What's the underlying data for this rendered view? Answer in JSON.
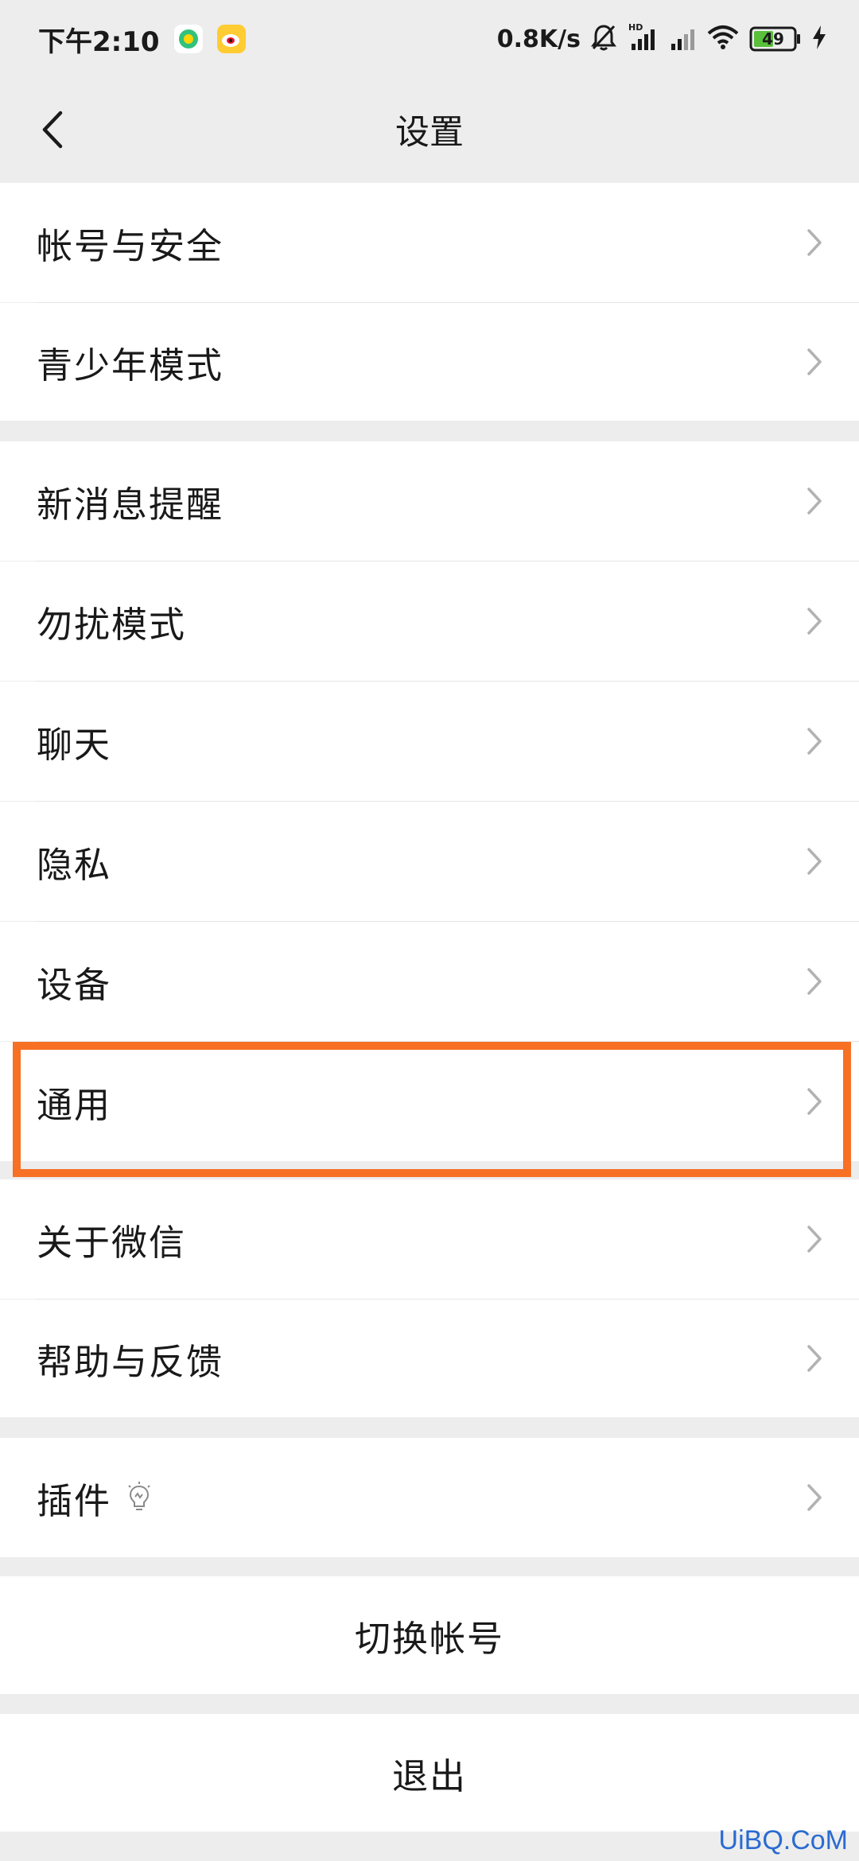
{
  "status_bar": {
    "time": "下午2:10",
    "app_icons": [
      "qq-music-icon",
      "weibo-icon"
    ],
    "net_speed": "0.8K/s",
    "battery": "49",
    "icons": [
      "bell-muted-icon",
      "signal-hd-icon",
      "signal-icon",
      "wifi-icon",
      "battery-icon",
      "charging-icon"
    ]
  },
  "nav": {
    "title": "设置",
    "back_icon": "chevron-left-icon"
  },
  "groups": [
    {
      "items": [
        {
          "label": "帐号与安全"
        },
        {
          "label": "青少年模式"
        }
      ]
    },
    {
      "items": [
        {
          "label": "新消息提醒"
        },
        {
          "label": "勿扰模式"
        },
        {
          "label": "聊天"
        },
        {
          "label": "隐私"
        },
        {
          "label": "设备"
        },
        {
          "label": "通用"
        }
      ]
    },
    {
      "items": [
        {
          "label": "关于微信"
        },
        {
          "label": "帮助与反馈"
        }
      ]
    },
    {
      "items": [
        {
          "label": "插件"
        }
      ]
    }
  ],
  "actions": {
    "switch_account": "切换帐号",
    "logout": "退出"
  },
  "highlight": {
    "target": "通用",
    "color": "#f77024"
  },
  "colors": {
    "background": "#ededed",
    "cell": "#ffffff",
    "text": "#191919",
    "chevron": "#b2b2b2"
  },
  "watermark": "UiBQ.CoM"
}
